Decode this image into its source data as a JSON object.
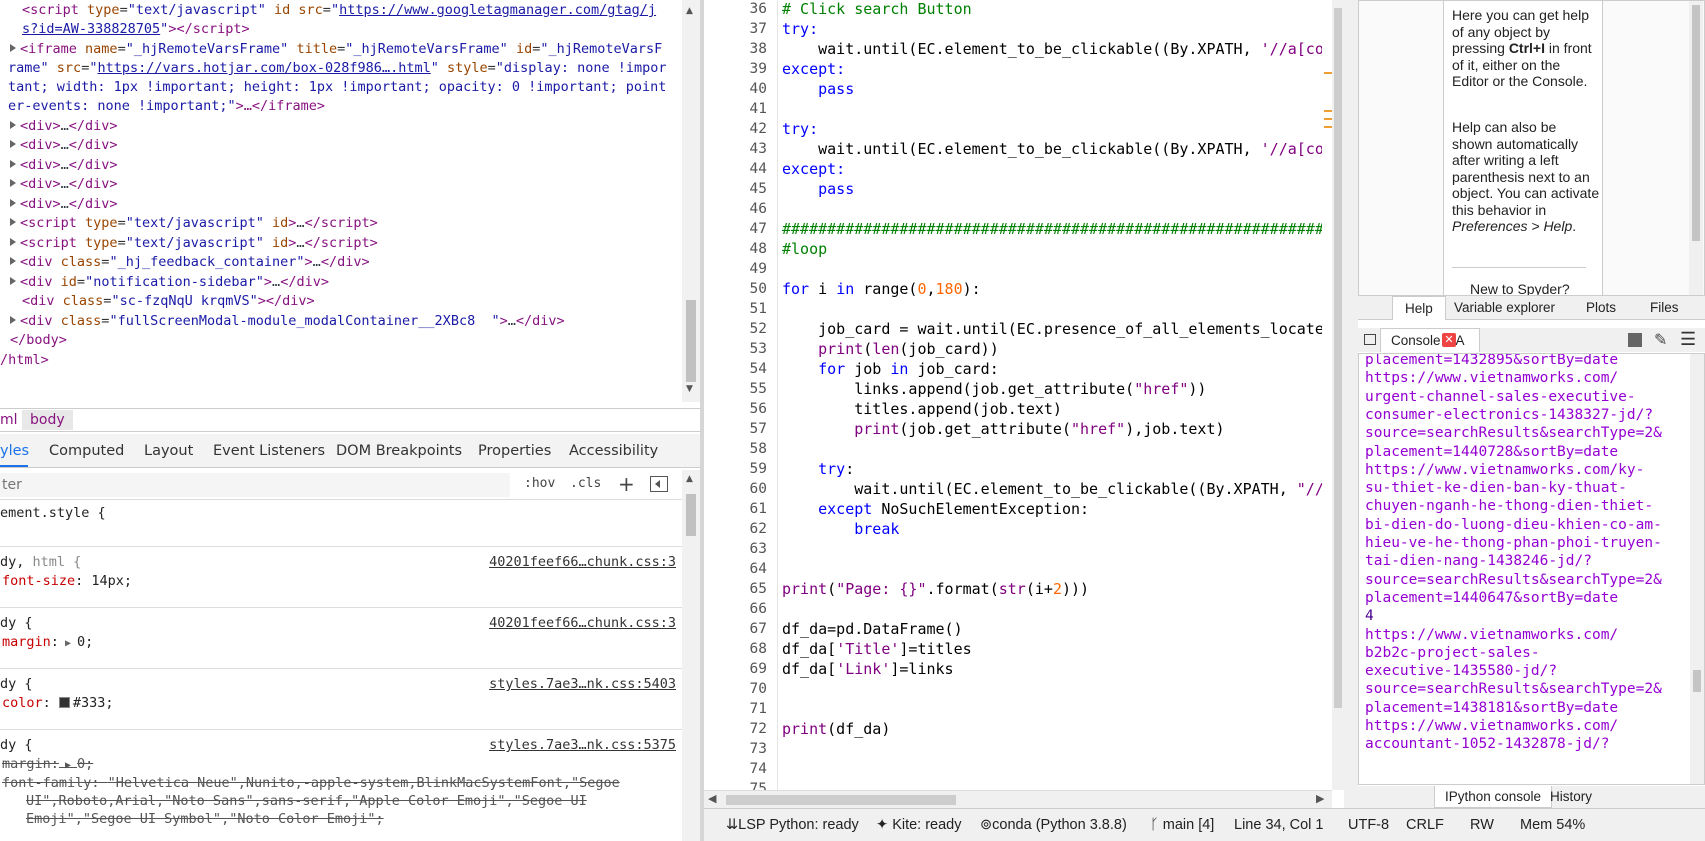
{
  "devtools": {
    "elements_lines": [
      {
        "html": "&lt;script type=\"text/javascript\" id src=\"https://www.googletagmanager.com/gtag/j"
      },
      {
        "html": "s?id=AW-338828705\"&gt;&lt;/script&gt;"
      },
      {
        "html": "&lt;iframe name=\"_hjRemoteVarsFrame\" title=\"_hjRemoteVarsFrame\" id=\"_hjRemoteVarsF"
      },
      {
        "html": "rame\" src=\"https://vars.hotjar.com/box-028f986….html\" style=\"display: none !impor"
      },
      {
        "html": "tant; width: 1px !important; height: 1px !important; opacity: 0 !important; point"
      },
      {
        "html": "er-events: none !important;\"&gt;…&lt;/iframe&gt;"
      },
      {
        "html": "&lt;div&gt;…&lt;/div&gt;"
      },
      {
        "html": "&lt;div&gt;…&lt;/div&gt;"
      },
      {
        "html": "&lt;div&gt;…&lt;/div&gt;"
      },
      {
        "html": "&lt;div&gt;…&lt;/div&gt;"
      },
      {
        "html": "&lt;div&gt;…&lt;/div&gt;"
      },
      {
        "html": "&lt;script type=\"text/javascript\" id&gt;…&lt;/script&gt;"
      },
      {
        "html": "&lt;script type=\"text/javascript\" id&gt;…&lt;/script&gt;"
      },
      {
        "html": "&lt;div class=\"_hj_feedback_container\"&gt;…&lt;/div&gt;"
      },
      {
        "html": "&lt;div id=\"notification-sidebar\"&gt;…&lt;/div&gt;"
      },
      {
        "html": "&lt;div class=\"sc-fzqNqU krqmVS\"&gt;&lt;/div&gt;"
      },
      {
        "html": "&lt;div class=\"fullScreenModal-module_modalContainer__2XBc8  \"&gt;…&lt;/div&gt;"
      },
      {
        "html": "&lt;/body&gt;"
      },
      {
        "html": "/html&gt;"
      }
    ],
    "tree": {
      "gtm_src_1": "https://www.googletagmanager.com/gtag/j",
      "gtm_src_2": "s?id=AW-338828705",
      "iframe_name": "_hjRemoteVarsFrame",
      "iframe_title": "_hjRemoteVarsFrame",
      "iframe_id_1": "_hjRemoteVarsF",
      "iframe_id_2": "rame",
      "iframe_src": "https://vars.hotjar.com/box-028f986….html",
      "iframe_style_1": "display: none !impor",
      "iframe_style_2": "tant; width: 1px !important; height: 1px !important; opacity: 0 !important; point",
      "iframe_style_3": "er-events: none !important;",
      "div_feedback": "_hj_feedback_container",
      "div_notification": "notification-sidebar",
      "div_sc": "sc-fzqNqU krqmVS",
      "div_modal": "fullScreenModal-module_modalContainer__2XBc8  "
    },
    "breadcrumbs": [
      "ml",
      "body"
    ],
    "style_tabs": [
      "yles",
      "Computed",
      "Layout",
      "Event Listeners",
      "DOM Breakpoints",
      "Properties",
      "Accessibility"
    ],
    "filter_placeholder": "ter",
    "hov_label": ":hov",
    "cls_label": ".cls",
    "plus_label": "+",
    "rules": {
      "r1_selector": "ement.style {",
      "r1_close": "}",
      "r2_selector_a": "dy, ",
      "r2_selector_b": "html {",
      "r2_source": "40201feef66…chunk.css:3",
      "r2_prop": "font-size",
      "r2_value": "14px;",
      "r3_selector": "dy {",
      "r3_source": "40201feef66…chunk.css:3",
      "r3_prop": "margin",
      "r3_value": "0;",
      "r4_selector": "dy {",
      "r4_source": "styles.7ae3…nk.css:5403",
      "r4_prop": "color",
      "r4_value": "#333;",
      "r5_selector": "dy {",
      "r5_source": "styles.7ae3…nk.css:5375",
      "r5_prop1": "margin",
      "r5_value1": "0;",
      "r5_prop2": "font-family",
      "r5_value2a": "\"Helvetica Neue\",Nunito,-apple-system,BlinkMacSystemFont,\"Segoe",
      "r5_value2b": "UI\",Roboto,Arial,\"Noto Sans\",sans-serif,\"Apple Color Emoji\",\"Segoe UI",
      "r5_value2c": "Emoji\",\"Segoe UI Symbol\",\"Noto Color Emoji\";"
    },
    "colors": {
      "tag": "#881280",
      "attr": "#994500",
      "value": "#1a1aa6",
      "active_tab": "#1a73e8"
    }
  },
  "editor": {
    "line_numbers": [
      "36",
      "37",
      "38",
      "39",
      "40",
      "41",
      "42",
      "43",
      "44",
      "45",
      "46",
      "47",
      "48",
      "49",
      "50",
      "51",
      "52",
      "53",
      "54",
      "55",
      "56",
      "57",
      "58",
      "59",
      "60",
      "61",
      "62",
      "63",
      "64",
      "65",
      "66",
      "67",
      "68",
      "69",
      "70",
      "71",
      "72",
      "73",
      "74",
      "75"
    ],
    "code": {
      "l36": "# Click search Button",
      "l37": "try:",
      "l38_a": "    wait.until(EC.element_to_be_clickable((By.XPATH, ",
      "l38_b": "'//a[co",
      "l39": "except:",
      "l40": "    pass",
      "l42": "try:",
      "l43_a": "    wait.until(EC.element_to_be_clickable((By.XPATH, ",
      "l43_b": "'//a[co",
      "l44": "except:",
      "l45": "    pass",
      "l47": "##############################################################",
      "l48": "#loop",
      "l50_a": "for",
      "l50_b": " i ",
      "l50_c": "in",
      "l50_d": " range(",
      "l50_e": "0",
      "l50_f": ",",
      "l50_g": "180",
      "l50_h": "):",
      "l52": "    job_card = wait.until(EC.presence_of_all_elements_locate",
      "l53_a": "    ",
      "l53_b": "print",
      "l53_c": "(",
      "l53_d": "len",
      "l53_e": "(job_card))",
      "l54_a": "    ",
      "l54_b": "for",
      "l54_c": " job ",
      "l54_d": "in",
      "l54_e": " job_card:",
      "l55_a": "        links.append(job.get_attribute(",
      "l55_b": "\"href\"",
      "l55_c": "))",
      "l56": "        titles.append(job.text)",
      "l57_a": "        ",
      "l57_b": "print",
      "l57_c": "(job.get_attribute(",
      "l57_d": "\"href\"",
      "l57_e": "),job.text)",
      "l59_a": "    ",
      "l59_b": "try",
      "l59_c": ":",
      "l60_a": "        wait.until(EC.element_to_be_clickable((By.XPATH, ",
      "l60_b": "\"//",
      "l61_a": "    ",
      "l61_b": "except",
      "l61_c": " NoSuchElementException:",
      "l62_a": "        ",
      "l62_b": "break",
      "l65_a": "print",
      "l65_b": "(",
      "l65_c": "\"Page: {}\"",
      "l65_d": ".format(",
      "l65_e": "str",
      "l65_f": "(i+",
      "l65_g": "2",
      "l65_h": ")))",
      "l67": "df_da=pd.DataFrame()",
      "l68_a": "df_da[",
      "l68_b": "'Title'",
      "l68_c": "]=titles",
      "l69_a": "df_da[",
      "l69_b": "'Link'",
      "l69_c": "]=links",
      "l72_a": "print",
      "l72_b": "(df_da)"
    },
    "colors": {
      "keyword": "#0000ff",
      "comment": "#008000",
      "string": "#800080",
      "number": "#ff6600"
    }
  },
  "help": {
    "p1_a": "Here you can get help of any object by pressing ",
    "p1_b": "Ctrl+I",
    "p1_c": " in front of it, either on the Editor or the Console.",
    "p2_a": "Help can also be shown automatically after writing a left parenthesis next to an object. You can activate this behavior in ",
    "p2_b": "Preferences > Help",
    "p2_c": ".",
    "new_to": "New to Spyder?",
    "tabs": [
      "Help",
      "Variable explorer",
      "Plots",
      "Files"
    ]
  },
  "console": {
    "tab_label": "Console 1/A",
    "close_glyph": "✕",
    "lines": [
      "placement=1432895&sortBy=date",
      "https://www.vietnamworks.com/",
      "urgent-channel-sales-executive-",
      "consumer-electronics-1438327-jd/?",
      "source=searchResults&searchType=2&",
      "placement=1440728&sortBy=date",
      "https://www.vietnamworks.com/ky-",
      "su-thiet-ke-dien-ban-ky-thuat-",
      "chuyen-nganh-he-thong-dien-thiet-",
      "bi-dien-do-luong-dieu-khien-co-am-",
      "hieu-ve-he-thong-phan-phoi-truyen-",
      "tai-dien-nang-1438246-jd/?",
      "source=searchResults&searchType=2&",
      "placement=1440647&sortBy=date",
      "4",
      "https://www.vietnamworks.com/",
      "b2b2c-project-sales-",
      "executive-1435580-jd/?",
      "source=searchResults&searchType=2&",
      "placement=1438181&sortBy=date",
      "https://www.vietnamworks.com/",
      "accountant-1052-1432878-jd/?"
    ],
    "bottom_tabs": [
      "IPython console",
      "History"
    ],
    "color": "#9400d3"
  },
  "statusbar": {
    "lsp": "LSP Python: ready",
    "kite": "Kite: ready",
    "conda": "conda (Python 3.8.8)",
    "git": "main [4]",
    "position": "Line 34, Col 1",
    "encoding": "UTF-8",
    "eol": "CRLF",
    "rw": "RW",
    "mem": "Mem 54%"
  }
}
